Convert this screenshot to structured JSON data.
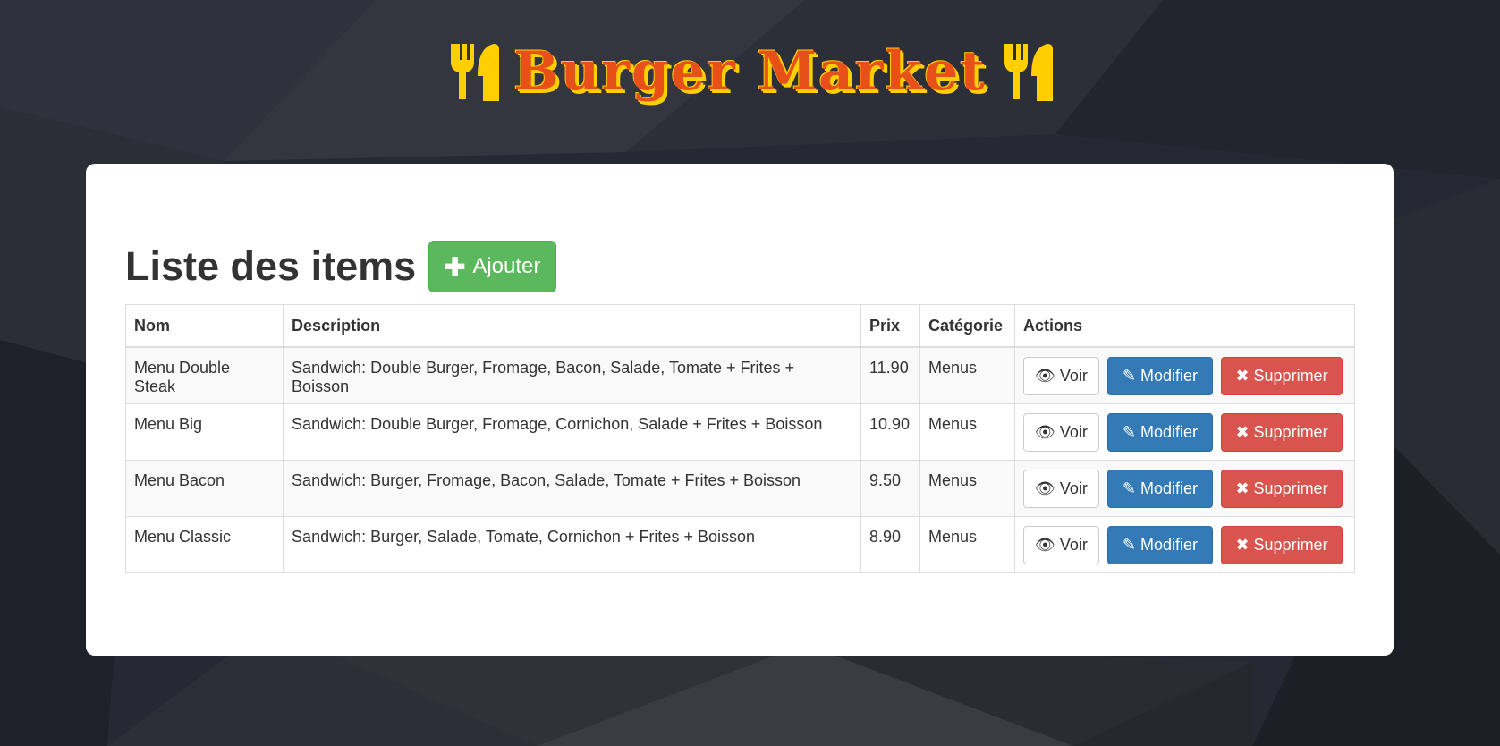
{
  "brand": {
    "title_main": "Burger",
    "title_second": "Market"
  },
  "page": {
    "title": "Liste des items",
    "add_button_label": "Ajouter"
  },
  "table": {
    "headers": {
      "nom": "Nom",
      "description": "Description",
      "prix": "Prix",
      "categorie": "Catégorie",
      "actions": "Actions"
    },
    "rows": [
      {
        "nom": "Menu Double Steak",
        "description": "Sandwich: Double Burger, Fromage, Bacon, Salade, Tomate + Frites + Boisson",
        "prix": "11.90",
        "categorie": "Menus"
      },
      {
        "nom": "Menu Big",
        "description": "Sandwich: Double Burger, Fromage, Cornichon, Salade + Frites + Boisson",
        "prix": "10.90",
        "categorie": "Menus"
      },
      {
        "nom": "Menu Bacon",
        "description": "Sandwich: Burger, Fromage, Bacon, Salade, Tomate + Frites + Boisson",
        "prix": "9.50",
        "categorie": "Menus"
      },
      {
        "nom": "Menu Classic",
        "description": "Sandwich: Burger, Salade, Tomate, Cornichon + Frites + Boisson",
        "prix": "8.90",
        "categorie": "Menus"
      }
    ],
    "action_labels": {
      "view": "Voir",
      "edit": "Modifier",
      "delete": "Supprimer"
    }
  },
  "icons": {
    "header_left": "cutlery-icon",
    "header_right": "cutlery-icon",
    "add": "plus-icon",
    "view": "eye-icon",
    "edit": "pencil-icon",
    "delete": "remove-icon"
  },
  "colors": {
    "brand_text": "#e8501a",
    "brand_shadow": "#ffcf00",
    "add_button": "#5cb85c",
    "edit_button": "#337ab7",
    "delete_button": "#d9534f"
  }
}
